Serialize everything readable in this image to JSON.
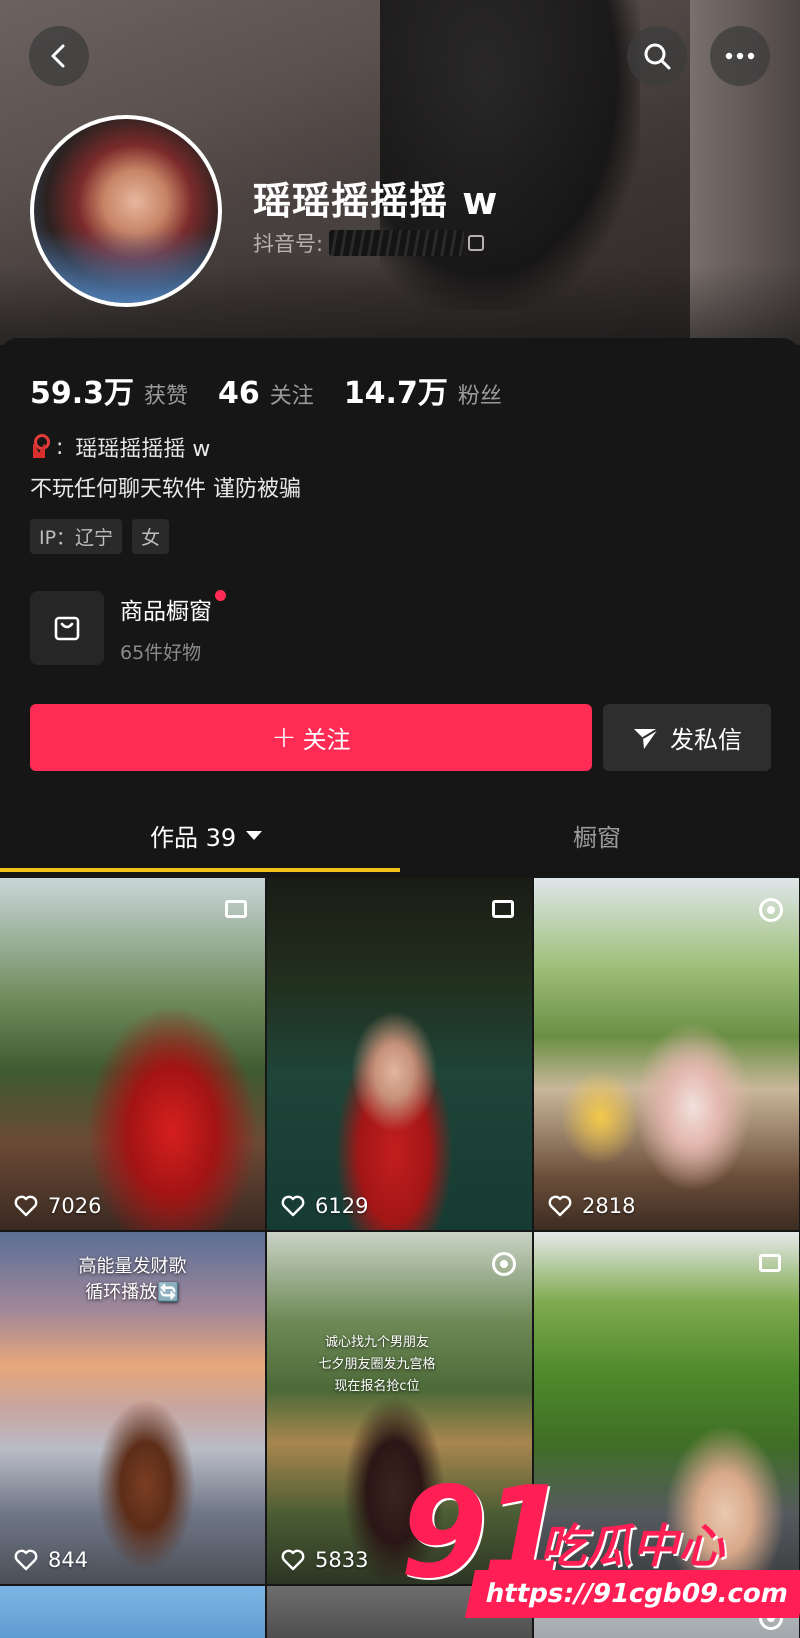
{
  "header": {
    "profile_name": "瑶瑶摇摇摇 w",
    "id_label": "抖音号:"
  },
  "stats": [
    {
      "value": "59.3万",
      "label": "获赞"
    },
    {
      "value": "46",
      "label": "关注"
    },
    {
      "value": "14.7万",
      "label": "粉丝"
    }
  ],
  "bio": {
    "colon": ":",
    "line1": "瑶瑶摇摇摇 w",
    "line2": "不玩任何聊天软件 谨防被骗"
  },
  "tags": [
    "IP：辽宁",
    "女"
  ],
  "shop": {
    "title": "商品橱窗",
    "subtitle": "65件好物"
  },
  "actions": {
    "follow_plus": "+",
    "follow_label": "关注",
    "message_label": "发私信"
  },
  "tabs": {
    "works_label": "作品 39",
    "shop_label": "橱窗"
  },
  "videos": [
    {
      "likes": "7026"
    },
    {
      "likes": "6129"
    },
    {
      "likes": "2818"
    },
    {
      "likes": "844",
      "overlay_line1": "高能量发财歌",
      "overlay_line2": "循环播放🔄"
    },
    {
      "likes": "5833",
      "overlay_line1": "诚心找九个男朋友",
      "overlay_line2": "七夕朋友圈发九宫格",
      "overlay_line3": "现在报名抢c位"
    },
    {
      "likes": ""
    }
  ],
  "watermark": {
    "number": "91",
    "text": "吃瓜中心",
    "url": "https://91cgb09.com"
  },
  "colors": {
    "accent_red": "#fe2c55",
    "tab_indicator": "#f4c31a",
    "background": "#161616"
  }
}
